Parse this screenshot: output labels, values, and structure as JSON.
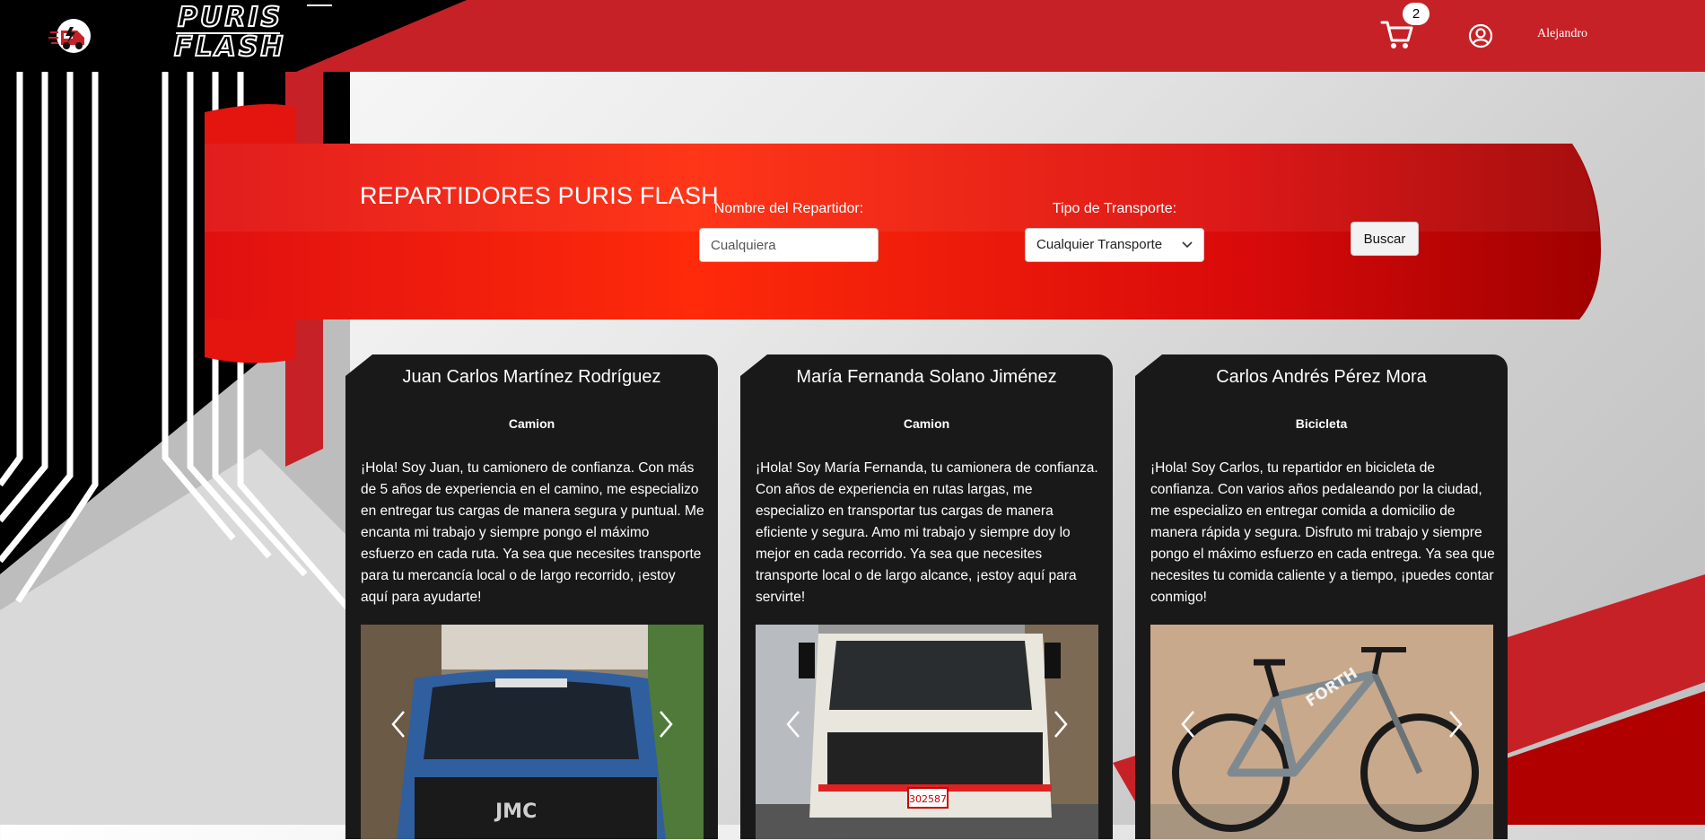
{
  "header": {
    "logo_text": "PURIS FLASH",
    "cart_count": "2",
    "user_name": "Alejandro"
  },
  "banner": {
    "title": "REPARTIDORES PURIS FLASH",
    "name_filter_label": "Nombre del Repartidor:",
    "name_filter_placeholder": "Cualquiera",
    "transport_filter_label": "Tipo de Transporte:",
    "transport_filter_value": "Cualquier Transporte",
    "search_button": "Buscar"
  },
  "couriers": [
    {
      "name": "Juan Carlos Martínez Rodríguez",
      "transport": "Camion",
      "description": "¡Hola! Soy Juan, tu camionero de confianza. Con más de 5 años de experiencia en el camino, me especializo en entregar tus cargas de manera segura y puntual. Me encanta mi trabajo y siempre pongo el máximo esfuerzo en cada ruta. Ya sea que necesites transporte para tu mercancía local o de largo recorrido, ¡estoy aquí para ayudarte!",
      "photo": "blue-truck-photo"
    },
    {
      "name": "María Fernanda Solano Jiménez",
      "transport": "Camion",
      "description": "¡Hola! Soy María Fernanda, tu camionera de confianza. Con años de experiencia en rutas largas, me especializo en transportar tus cargas de manera eficiente y segura. Amo mi trabajo y siempre doy lo mejor en cada recorrido. Ya sea que necesites transporte local o de largo alcance, ¡estoy aquí para servirte!",
      "photo": "white-truck-photo",
      "plate": "302587"
    },
    {
      "name": "Carlos Andrés Pérez Mora",
      "transport": "Bicicleta",
      "description": "¡Hola! Soy Carlos, tu repartidor en bicicleta de confianza. Con varios años pedaleando por la ciudad, me especializo en entregar comida a domicilio de manera rápida y segura. Disfruto mi trabajo y siempre pongo el máximo esfuerzo en cada entrega. Ya sea que necesites tu comida caliente y a tiempo, ¡puedes contar conmigo!",
      "photo": "bicycle-photo",
      "brand": "FORTH"
    }
  ],
  "colors": {
    "header_red": "#c62127",
    "banner_red": "#e4140f",
    "card_bg": "#191919"
  }
}
